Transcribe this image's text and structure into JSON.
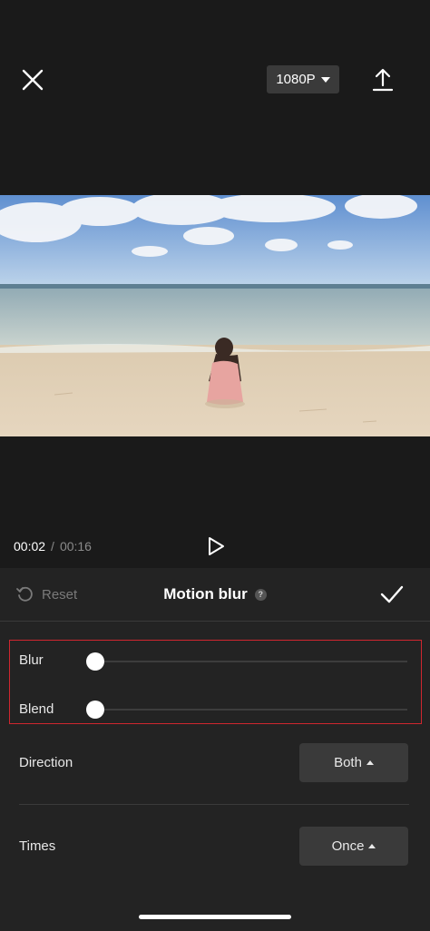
{
  "topbar": {
    "resolution": "1080P"
  },
  "player": {
    "current_time": "00:02",
    "separator": "/",
    "duration": "00:16"
  },
  "panel": {
    "reset_label": "Reset",
    "title": "Motion blur",
    "help_label": "?",
    "sliders": [
      {
        "label": "Blur",
        "value": 0
      },
      {
        "label": "Blend",
        "value": 0
      }
    ],
    "direction": {
      "label": "Direction",
      "value": "Both"
    },
    "times": {
      "label": "Times",
      "value": "Once"
    }
  },
  "colors": {
    "highlight": "#d0262f",
    "panel_bg": "#232323",
    "button_bg": "#3a3a3a"
  },
  "icons": [
    "close-icon",
    "chevron-down-icon",
    "export-icon",
    "play-icon",
    "reset-icon",
    "help-icon",
    "check-icon",
    "chevron-up-icon"
  ]
}
